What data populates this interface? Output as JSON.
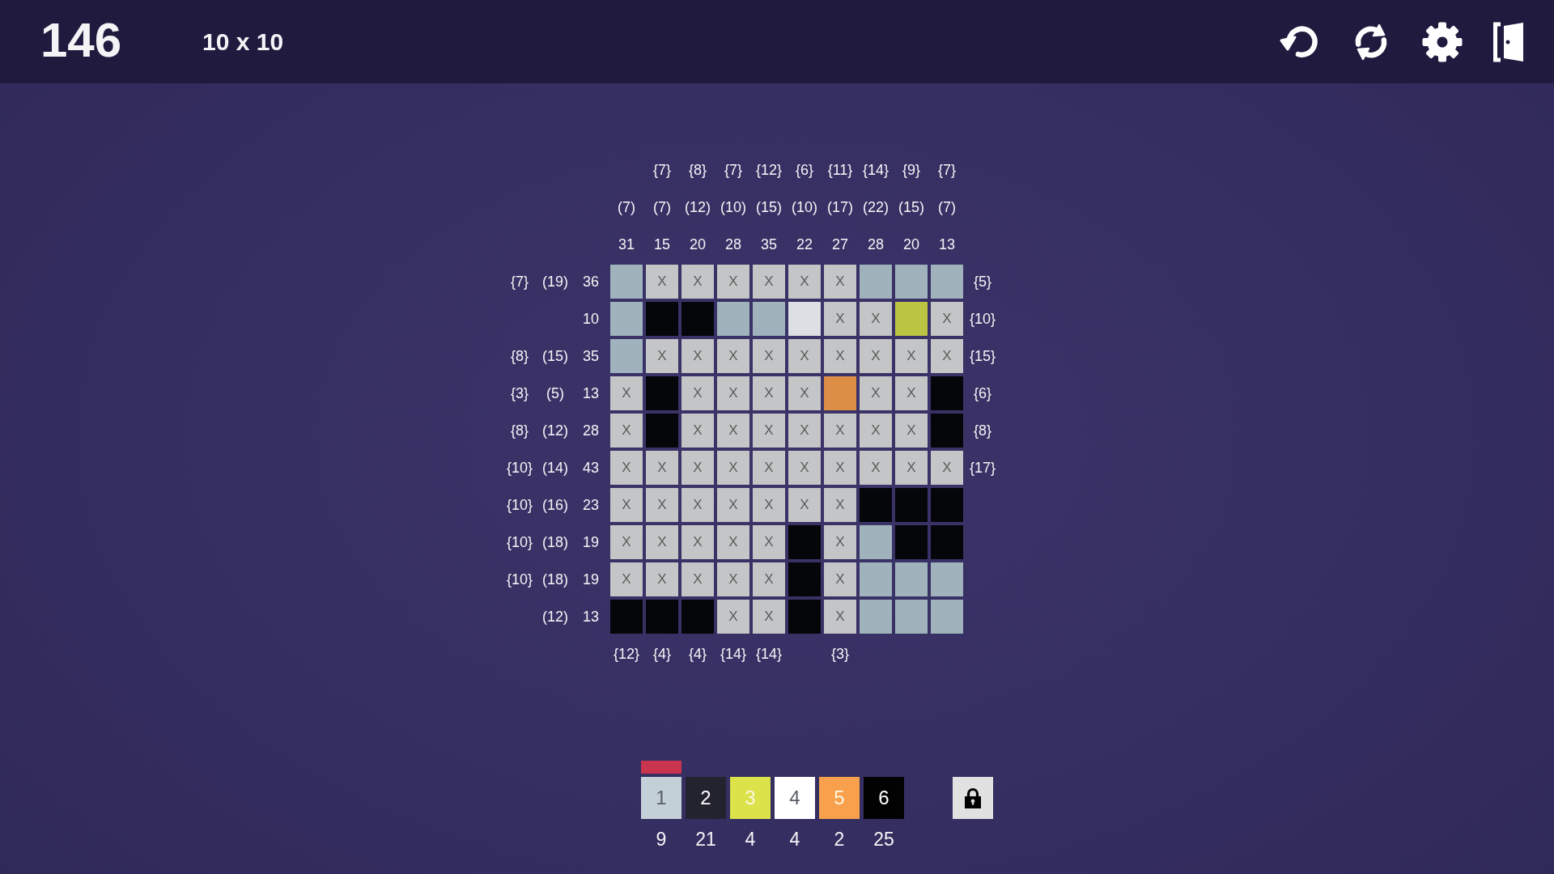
{
  "header": {
    "number": "146",
    "grid_size": "10 x 10"
  },
  "board": {
    "column_clues": [
      {
        "paren_clue": "(7)",
        "number_clue": "31",
        "bottom_brace_clue": "{12}"
      },
      {
        "top_brace_clue": "{7}",
        "paren_clue": "(7)",
        "number_clue": "15",
        "bottom_brace_clue": "{4}"
      },
      {
        "top_brace_clue": "{8}",
        "paren_clue": "(12)",
        "number_clue": "20",
        "bottom_brace_clue": "{4}"
      },
      {
        "top_brace_clue": "{7}",
        "paren_clue": "(10)",
        "number_clue": "28",
        "bottom_brace_clue": "{14}"
      },
      {
        "top_brace_clue": "{12}",
        "paren_clue": "(15)",
        "number_clue": "35",
        "bottom_brace_clue": "{14}"
      },
      {
        "top_brace_clue": "{6}",
        "paren_clue": "(10)",
        "number_clue": "22"
      },
      {
        "top_brace_clue": "{11}",
        "paren_clue": "(17)",
        "number_clue": "27",
        "bottom_brace_clue": "{3}"
      },
      {
        "top_brace_clue": "{14}",
        "paren_clue": "(22)",
        "number_clue": "28"
      },
      {
        "top_brace_clue": "{9}",
        "paren_clue": "(15)",
        "number_clue": "20"
      },
      {
        "top_brace_clue": "{7}",
        "paren_clue": "(7)",
        "number_clue": "13"
      }
    ],
    "rows": [
      {
        "left_brace_clue": "{7}",
        "paren_clue": "(19)",
        "number_clue": "36",
        "right_brace_clue": "{5}",
        "cells": [
          {
            "kind": "filled",
            "color": "#a0b3bd"
          },
          {
            "kind": "crossed",
            "text": "X"
          },
          {
            "kind": "crossed",
            "text": "X"
          },
          {
            "kind": "crossed",
            "text": "X"
          },
          {
            "kind": "crossed",
            "text": "X"
          },
          {
            "kind": "crossed",
            "text": "X"
          },
          {
            "kind": "crossed",
            "text": "X"
          },
          {
            "kind": "filled",
            "color": "#a0b3bd"
          },
          {
            "kind": "filled",
            "color": "#a0b3bd"
          },
          {
            "kind": "filled",
            "color": "#a0b3bd"
          }
        ]
      },
      {
        "number_clue": "10",
        "right_brace_clue": "{10}",
        "cells": [
          {
            "kind": "filled",
            "color": "#a0b3bd"
          },
          {
            "kind": "filled",
            "color": "#04060a"
          },
          {
            "kind": "filled",
            "color": "#04060a"
          },
          {
            "kind": "filled",
            "color": "#a0b3bd"
          },
          {
            "kind": "filled",
            "color": "#a0b3bd"
          },
          {
            "kind": "filled",
            "color": "#dcdfe3"
          },
          {
            "kind": "crossed",
            "text": "X"
          },
          {
            "kind": "crossed",
            "text": "X"
          },
          {
            "kind": "filled",
            "color": "#bcc444"
          },
          {
            "kind": "crossed",
            "text": "X"
          }
        ]
      },
      {
        "left_brace_clue": "{8}",
        "paren_clue": "(15)",
        "number_clue": "35",
        "right_brace_clue": "{15}",
        "cells": [
          {
            "kind": "filled",
            "color": "#a0b3bd"
          },
          {
            "kind": "crossed",
            "text": "X"
          },
          {
            "kind": "crossed",
            "text": "X"
          },
          {
            "kind": "crossed",
            "text": "X"
          },
          {
            "kind": "crossed",
            "text": "X"
          },
          {
            "kind": "crossed",
            "text": "X"
          },
          {
            "kind": "crossed",
            "text": "X"
          },
          {
            "kind": "crossed",
            "text": "X"
          },
          {
            "kind": "crossed",
            "text": "X"
          },
          {
            "kind": "crossed",
            "text": "X"
          }
        ]
      },
      {
        "left_brace_clue": "{3}",
        "paren_clue": "(5)",
        "number_clue": "13",
        "right_brace_clue": "{6}",
        "cells": [
          {
            "kind": "crossed",
            "text": "X"
          },
          {
            "kind": "filled",
            "color": "#04060a"
          },
          {
            "kind": "crossed",
            "text": "X"
          },
          {
            "kind": "crossed",
            "text": "X"
          },
          {
            "kind": "crossed",
            "text": "X"
          },
          {
            "kind": "crossed",
            "text": "X"
          },
          {
            "kind": "filled",
            "color": "#dc8e46"
          },
          {
            "kind": "crossed",
            "text": "X"
          },
          {
            "kind": "crossed",
            "text": "X"
          },
          {
            "kind": "filled",
            "color": "#04060a"
          }
        ]
      },
      {
        "left_brace_clue": "{8}",
        "paren_clue": "(12)",
        "number_clue": "28",
        "right_brace_clue": "{8}",
        "cells": [
          {
            "kind": "crossed",
            "text": "X"
          },
          {
            "kind": "filled",
            "color": "#04060a"
          },
          {
            "kind": "crossed",
            "text": "X"
          },
          {
            "kind": "crossed",
            "text": "X"
          },
          {
            "kind": "crossed",
            "text": "X"
          },
          {
            "kind": "crossed",
            "text": "X"
          },
          {
            "kind": "crossed",
            "text": "X"
          },
          {
            "kind": "crossed",
            "text": "X"
          },
          {
            "kind": "crossed",
            "text": "X"
          },
          {
            "kind": "filled",
            "color": "#04060a"
          }
        ]
      },
      {
        "left_brace_clue": "{10}",
        "paren_clue": "(14)",
        "number_clue": "43",
        "right_brace_clue": "{17}",
        "cells": [
          {
            "kind": "crossed",
            "text": "X"
          },
          {
            "kind": "crossed",
            "text": "X"
          },
          {
            "kind": "crossed",
            "text": "X"
          },
          {
            "kind": "crossed",
            "text": "X"
          },
          {
            "kind": "crossed",
            "text": "X"
          },
          {
            "kind": "crossed",
            "text": "X"
          },
          {
            "kind": "crossed",
            "text": "X"
          },
          {
            "kind": "crossed",
            "text": "X"
          },
          {
            "kind": "crossed",
            "text": "X"
          },
          {
            "kind": "crossed",
            "text": "X"
          }
        ]
      },
      {
        "left_brace_clue": "{10}",
        "paren_clue": "(16)",
        "number_clue": "23",
        "cells": [
          {
            "kind": "crossed",
            "text": "X"
          },
          {
            "kind": "crossed",
            "text": "X"
          },
          {
            "kind": "crossed",
            "text": "X"
          },
          {
            "kind": "crossed",
            "text": "X"
          },
          {
            "kind": "crossed",
            "text": "X"
          },
          {
            "kind": "crossed",
            "text": "X"
          },
          {
            "kind": "crossed",
            "text": "X"
          },
          {
            "kind": "filled",
            "color": "#04060a"
          },
          {
            "kind": "filled",
            "color": "#04060a"
          },
          {
            "kind": "filled",
            "color": "#04060a"
          }
        ]
      },
      {
        "left_brace_clue": "{10}",
        "paren_clue": "(18)",
        "number_clue": "19",
        "cells": [
          {
            "kind": "crossed",
            "text": "X"
          },
          {
            "kind": "crossed",
            "text": "X"
          },
          {
            "kind": "crossed",
            "text": "X"
          },
          {
            "kind": "crossed",
            "text": "X"
          },
          {
            "kind": "crossed",
            "text": "X"
          },
          {
            "kind": "filled",
            "color": "#04060a"
          },
          {
            "kind": "crossed",
            "text": "X"
          },
          {
            "kind": "filled",
            "color": "#a0b3bd"
          },
          {
            "kind": "filled",
            "color": "#04060a"
          },
          {
            "kind": "filled",
            "color": "#04060a"
          }
        ]
      },
      {
        "left_brace_clue": "{10}",
        "paren_clue": "(18)",
        "number_clue": "19",
        "cells": [
          {
            "kind": "crossed",
            "text": "X"
          },
          {
            "kind": "crossed",
            "text": "X"
          },
          {
            "kind": "crossed",
            "text": "X"
          },
          {
            "kind": "crossed",
            "text": "X"
          },
          {
            "kind": "crossed",
            "text": "X"
          },
          {
            "kind": "filled",
            "color": "#04060a"
          },
          {
            "kind": "crossed",
            "text": "X"
          },
          {
            "kind": "filled",
            "color": "#a0b3bd"
          },
          {
            "kind": "filled",
            "color": "#a0b3bd"
          },
          {
            "kind": "filled",
            "color": "#a0b3bd"
          }
        ]
      },
      {
        "paren_clue": "(12)",
        "number_clue": "13",
        "cells": [
          {
            "kind": "filled",
            "color": "#04060a"
          },
          {
            "kind": "filled",
            "color": "#04060a"
          },
          {
            "kind": "filled",
            "color": "#04060a"
          },
          {
            "kind": "crossed",
            "text": "X"
          },
          {
            "kind": "crossed",
            "text": "X"
          },
          {
            "kind": "filled",
            "color": "#04060a"
          },
          {
            "kind": "crossed",
            "text": "X"
          },
          {
            "kind": "filled",
            "color": "#a0b3bd"
          },
          {
            "kind": "filled",
            "color": "#a0b3bd"
          },
          {
            "kind": "filled",
            "color": "#a0b3bd"
          }
        ]
      }
    ]
  },
  "palette": {
    "swatches": [
      {
        "label": "1",
        "color": "#c4d0d8",
        "count": "9",
        "selected": true
      },
      {
        "label": "2",
        "color": "#23222f",
        "count": "21",
        "selected": false
      },
      {
        "label": "3",
        "color": "#dbe24a",
        "count": "4",
        "selected": false
      },
      {
        "label": "4",
        "color": "#ffffff",
        "count": "4",
        "selected": false
      },
      {
        "label": "5",
        "color": "#f8a04b",
        "count": "2",
        "selected": false
      },
      {
        "label": "6",
        "color": "#020202",
        "count": "25",
        "selected": false
      }
    ]
  }
}
